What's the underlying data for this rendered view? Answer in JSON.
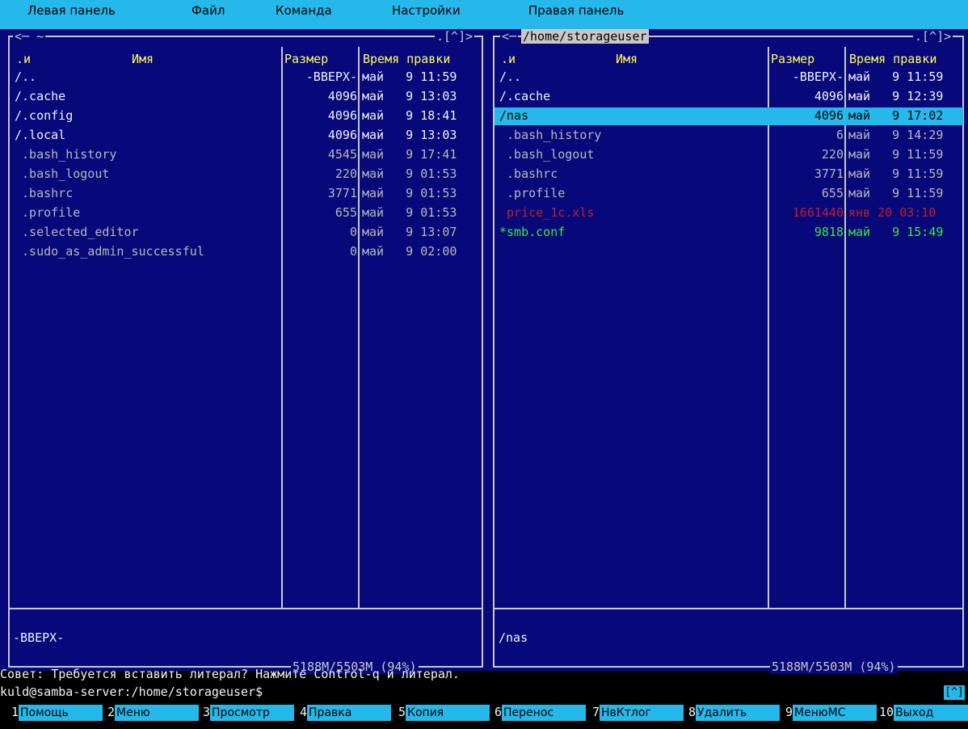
{
  "menubar": {
    "items": [
      "Левая панель",
      "Файл",
      "Команда",
      "Настройки",
      "Правая панель"
    ]
  },
  "left_panel": {
    "path_label": "<─ ~ ",
    "corner_label": ".[^]>",
    "headers": {
      "n": ".и",
      "name": "Имя",
      "size": "Размер",
      "mtime": "Время правки"
    },
    "rows": [
      {
        "name": "/..",
        "size": "-ВВЕРХ-",
        "date": "май   9 11:59",
        "style": "white"
      },
      {
        "name": "/.cache",
        "size": "4096",
        "date": "май   9 13:03",
        "style": "white"
      },
      {
        "name": "/.config",
        "size": "4096",
        "date": "май   9 18:41",
        "style": "white"
      },
      {
        "name": "/.local",
        "size": "4096",
        "date": "май   9 13:03",
        "style": "white"
      },
      {
        "name": " .bash_history",
        "size": "4545",
        "date": "май   9 17:41",
        "style": "grey"
      },
      {
        "name": " .bash_logout",
        "size": "220",
        "date": "май   9 01:53",
        "style": "grey"
      },
      {
        "name": " .bashrc",
        "size": "3771",
        "date": "май   9 01:53",
        "style": "grey"
      },
      {
        "name": " .profile",
        "size": "655",
        "date": "май   9 01:53",
        "style": "grey"
      },
      {
        "name": " .selected_editor",
        "size": "0",
        "date": "май   9 13:07",
        "style": "grey"
      },
      {
        "name": " .sudo_as_admin_successful",
        "size": "0",
        "date": "май   9 02:00",
        "style": "grey"
      }
    ],
    "status": "-ВВЕРХ-",
    "disk": " 5188M/5503M (94%) "
  },
  "right_panel": {
    "path_label": "/home/storageuser",
    "corner_label": ".[^]>",
    "headers": {
      "n": ".и",
      "name": "Имя",
      "size": "Размер",
      "mtime": "Время правки"
    },
    "rows": [
      {
        "name": "/..",
        "size": "-ВВЕРХ-",
        "date": "май   9 11:59",
        "style": "white"
      },
      {
        "name": "/.cache",
        "size": "4096",
        "date": "май   9 12:39",
        "style": "white"
      },
      {
        "name": "/nas",
        "size": "4096",
        "date": "май   9 17:02",
        "style": "selected"
      },
      {
        "name": " .bash_history",
        "size": "6",
        "date": "май   9 14:29",
        "style": "grey"
      },
      {
        "name": " .bash_logout",
        "size": "220",
        "date": "май   9 11:59",
        "style": "grey"
      },
      {
        "name": " .bashrc",
        "size": "3771",
        "date": "май   9 11:59",
        "style": "grey"
      },
      {
        "name": " .profile",
        "size": "655",
        "date": "май   9 11:59",
        "style": "grey"
      },
      {
        "name": " price_1c.xls",
        "size": "1661440",
        "date": "янв 20 03:10",
        "style": "red"
      },
      {
        "name": "*smb.conf",
        "size": "9818",
        "date": "май   9 15:49",
        "style": "green"
      }
    ],
    "status": "/nas",
    "disk": " 5188M/5503M (94%) "
  },
  "hint": "Совет: Требуется вставить литерал? Нажмите Control-q и литерал.",
  "prompt": "kuld@samba-server:/home/storageuser$",
  "cursor_label": "[^]",
  "fkeys": [
    {
      "num": "1",
      "label": "Помощь"
    },
    {
      "num": "2",
      "label": "Меню"
    },
    {
      "num": "3",
      "label": "Просмотр"
    },
    {
      "num": "4",
      "label": "Правка"
    },
    {
      "num": "5",
      "label": "Копия"
    },
    {
      "num": "6",
      "label": "Перенос"
    },
    {
      "num": "7",
      "label": "НвКтлог"
    },
    {
      "num": "8",
      "label": "Удалить"
    },
    {
      "num": "9",
      "label": "МенюMC"
    },
    {
      "num": "10",
      "label": "Выход"
    }
  ],
  "colors": {
    "blue": "#07087a",
    "cyan": "#25b9eb",
    "yellow": "#ffff54",
    "red": "#c12020",
    "green": "#3ee63e"
  }
}
